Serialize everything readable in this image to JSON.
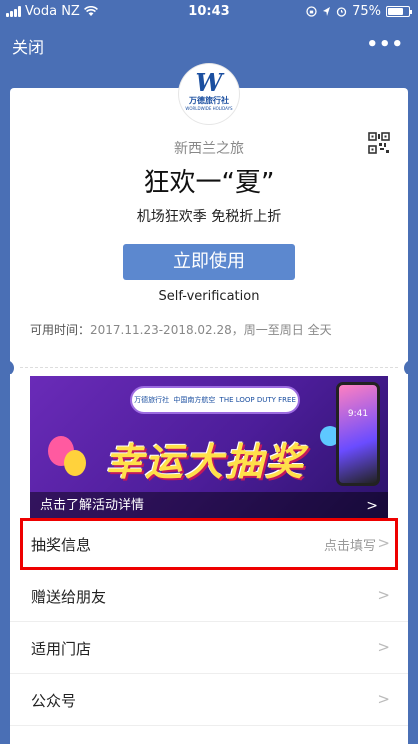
{
  "status": {
    "carrier": "Voda NZ",
    "time": "10:43",
    "battery": "75%",
    "battery_level": 0.75
  },
  "nav": {
    "close_label": "关闭",
    "more_label": "•••"
  },
  "card": {
    "logo_mark": "W",
    "logo_cn": "万德旅行社",
    "logo_en": "WORLDWIDE HOLIDAYS",
    "subtitle": "新西兰之旅",
    "title": "狂欢一“夏”",
    "description": "机场狂欢季 免税折上折",
    "use_button": "立即使用",
    "self_verification": "Self-verification",
    "valid_label": "可用时间：",
    "valid_value": "2017.11.23-2018.02.28，周一至周日 全天"
  },
  "banner": {
    "logo_1": "万德旅行社",
    "logo_2": "中国南方航空",
    "logo_3": "THE LOOP DUTY FREE",
    "headline": "幸运大抽奖",
    "phone_time": "9:41",
    "caption": "点击了解活动详情"
  },
  "rows": [
    {
      "label": "抽奖信息",
      "hint": "点击填写"
    },
    {
      "label": "赠送给朋友",
      "hint": ""
    },
    {
      "label": "适用门店",
      "hint": ""
    },
    {
      "label": "公众号",
      "hint": ""
    }
  ],
  "colors": {
    "background": "#4a6fb5",
    "button": "#5c88cf",
    "highlight": "#e00000"
  }
}
